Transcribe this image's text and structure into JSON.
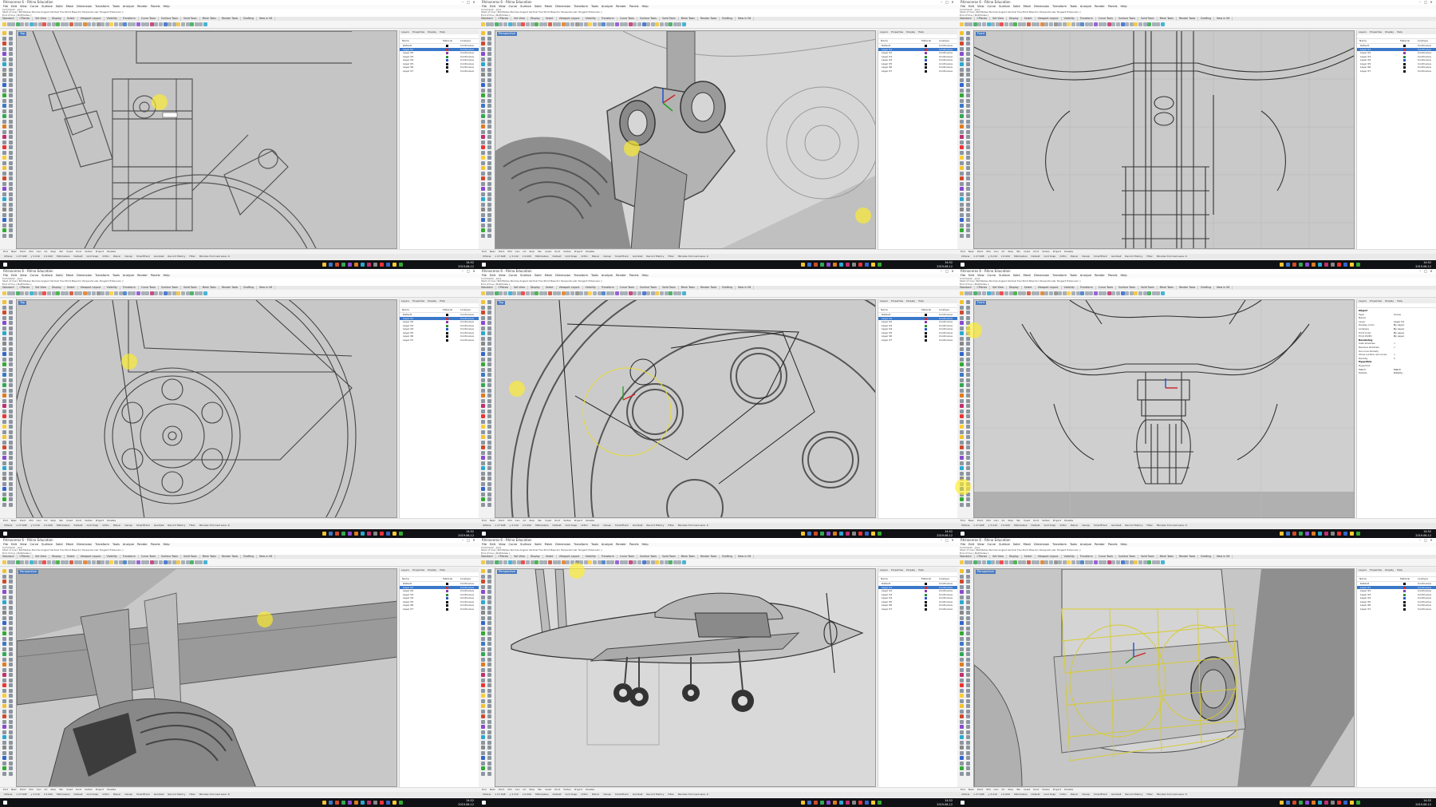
{
  "app": {
    "title": "Rhinoceros 6 - Rhino Education",
    "window_buttons": [
      "–",
      "□",
      "✕"
    ]
  },
  "menu": [
    "File",
    "Edit",
    "View",
    "Curve",
    "Surface",
    "Solid",
    "Mesh",
    "Dimension",
    "Transform",
    "Tools",
    "Analyze",
    "Render",
    "Panels",
    "Help"
  ],
  "tabs": [
    "Standard",
    "CPlanes",
    "Set View",
    "Display",
    "Select",
    "Viewport Layout",
    "Visibility",
    "Transform",
    "Curve Tools",
    "Surface Tools",
    "Solid Tools",
    "Mesh Tools",
    "Render Tools",
    "Drafting",
    "New in V6"
  ],
  "command_history": [
    "Command: _Line",
    "Start of line ( BothSides Normal Angled Vertical FourPoint Bisector Perpendicular Tangent Extension ):",
    "End of line ( BothSides ):",
    "Command:"
  ],
  "panel_tabs": [
    "Layers",
    "Properties",
    "Display",
    "Help"
  ],
  "layer_columns": {
    "name": "Name",
    "material": "Material",
    "linetype": "Linetype"
  },
  "layers": [
    {
      "name": "Default",
      "color": "#000000",
      "linetype": "Continuous"
    },
    {
      "name": "Layer 01",
      "color": "#d03030",
      "linetype": "Continuous"
    },
    {
      "name": "Layer 02",
      "color": "#8a3aa8",
      "linetype": "Continuous"
    },
    {
      "name": "Layer 03",
      "color": "#2e8b3e",
      "linetype": "Continuous"
    },
    {
      "name": "Layer 04",
      "color": "#2a56c6",
      "linetype": "Continuous"
    },
    {
      "name": "Layer 05",
      "color": "#111111",
      "linetype": "Continuous"
    },
    {
      "name": "Layer 06",
      "color": "#111111",
      "linetype": "Continuous"
    },
    {
      "name": "Layer 07",
      "color": "#111111",
      "linetype": "Continuous"
    }
  ],
  "properties": [
    {
      "label": "Object",
      "value": "",
      "group": true
    },
    {
      "label": "Type",
      "value": "Curve"
    },
    {
      "label": "Name",
      "value": ""
    },
    {
      "label": "Layer",
      "value": "Layer 01"
    },
    {
      "label": "Display Color",
      "value": "By Layer"
    },
    {
      "label": "Linetype",
      "value": "By Layer"
    },
    {
      "label": "Print Color",
      "value": "By Layer"
    },
    {
      "label": "Print Width",
      "value": "By Layer"
    },
    {
      "label": "Rendering",
      "value": "",
      "group": true
    },
    {
      "label": "Cast shadows",
      "value": "✓"
    },
    {
      "label": "Receive shadows",
      "value": "✓"
    },
    {
      "label": "Isocurve Density",
      "value": ""
    },
    {
      "label": "Show surface isocurves",
      "value": "✓"
    },
    {
      "label": "Density",
      "value": "1"
    },
    {
      "label": "Hyperlink",
      "value": "",
      "group": true
    },
    {
      "label": "Hyperlink",
      "value": ""
    },
    {
      "label": "Match",
      "value": "Match"
    },
    {
      "label": "Details",
      "value": "Details..."
    }
  ],
  "snaps": [
    "End",
    "Near",
    "Point",
    "Mid",
    "Cen",
    "Int",
    "Perp",
    "Tan",
    "Quad",
    "Knot",
    "Vertex",
    "Project",
    "Disable"
  ],
  "status": [
    "CPlane",
    "x 27.648",
    "y 3.210",
    "z 0.000",
    "Millimeters",
    "Default",
    "Grid Snap",
    "Ortho",
    "Planar",
    "Osnap",
    "SmartTrack",
    "Gumball",
    "Record History",
    "Filter",
    "Minutes from last save: 6"
  ],
  "taskbar": {
    "time": "14:52",
    "date": "2019-06-12"
  },
  "viewports": [
    {
      "label": "Top",
      "kind": "top-fork"
    },
    {
      "label": "Perspective",
      "kind": "persp-yoke"
    },
    {
      "label": "Front",
      "kind": "front-strut"
    },
    {
      "label": "Top",
      "kind": "top-wheel"
    },
    {
      "label": "Top",
      "kind": "top-hub"
    },
    {
      "label": "Front",
      "kind": "front-gear"
    },
    {
      "label": "Perspective",
      "kind": "persp-wing"
    },
    {
      "label": "Perspective",
      "kind": "persp-plane"
    },
    {
      "label": "Perspective",
      "kind": "persp-clamp"
    }
  ],
  "colors": {
    "selection": "#3b78c9",
    "cursor_highlight": "#ffee28",
    "viewport": "#c9c9c9",
    "taskbar": "#101114"
  }
}
